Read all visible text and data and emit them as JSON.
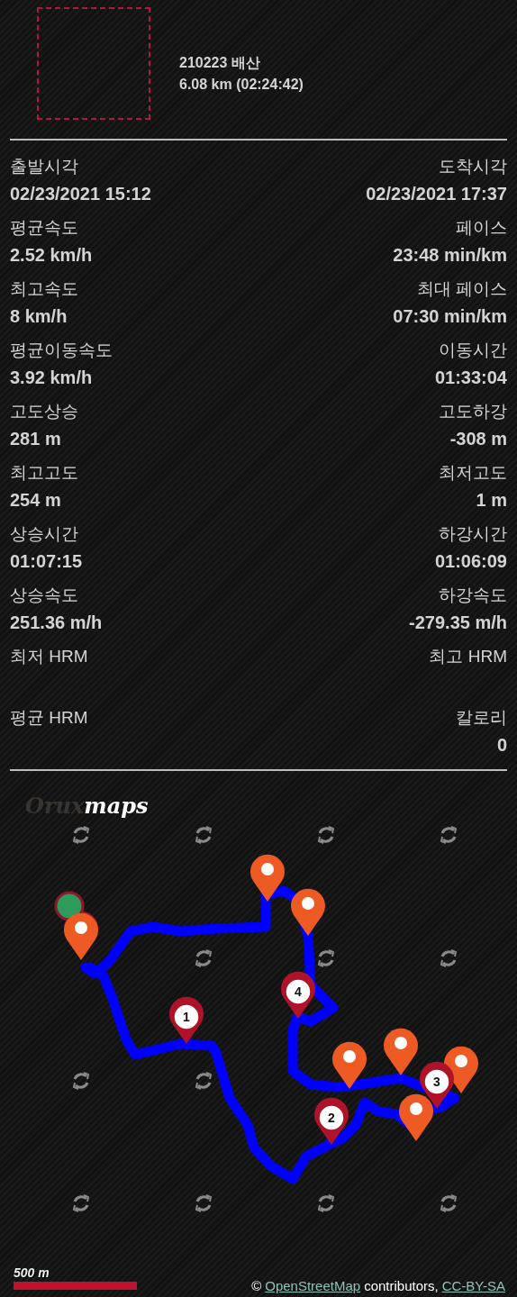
{
  "track": {
    "title": "210223 배산",
    "summary": "6.08 km (02:24:42)"
  },
  "stats": [
    {
      "left": {
        "label": "출발시각",
        "value": "02/23/2021 15:12"
      },
      "right": {
        "label": "도착시각",
        "value": "02/23/2021 17:37"
      }
    },
    {
      "left": {
        "label": "평균속도",
        "value": "2.52 km/h"
      },
      "right": {
        "label": "페이스",
        "value": "23:48 min/km"
      }
    },
    {
      "left": {
        "label": "최고속도",
        "value": "8 km/h"
      },
      "right": {
        "label": "최대 페이스",
        "value": "07:30 min/km"
      }
    },
    {
      "left": {
        "label": "평균이동속도",
        "value": "3.92 km/h"
      },
      "right": {
        "label": "이동시간",
        "value": "01:33:04"
      }
    },
    {
      "left": {
        "label": "고도상승",
        "value": "281 m"
      },
      "right": {
        "label": "고도하강",
        "value": "-308 m"
      }
    },
    {
      "left": {
        "label": "최고고도",
        "value": "254 m"
      },
      "right": {
        "label": "최저고도",
        "value": "1 m"
      }
    },
    {
      "left": {
        "label": "상승시간",
        "value": "01:07:15"
      },
      "right": {
        "label": "하강시간",
        "value": "01:06:09"
      }
    },
    {
      "left": {
        "label": "상승속도",
        "value": "251.36 m/h"
      },
      "right": {
        "label": "하강속도",
        "value": "-279.35 m/h"
      }
    },
    {
      "left": {
        "label": "최저 HRM"
      },
      "right": {
        "label": "최고 HRM"
      }
    },
    {
      "left": {
        "label": "평균 HRM"
      },
      "right": {
        "label": "칼로리",
        "value": "0"
      }
    }
  ],
  "map": {
    "logo_dim": "Orux",
    "logo_bright": "maps",
    "waypoints": [
      {
        "label": "1"
      },
      {
        "label": "2"
      },
      {
        "label": "3"
      },
      {
        "label": "4"
      }
    ],
    "scale": "500 m",
    "attribution": {
      "prefix": "©",
      "link": "OpenStreetMap",
      "middle": "contributors,",
      "license": "CC-BY-SA"
    }
  }
}
